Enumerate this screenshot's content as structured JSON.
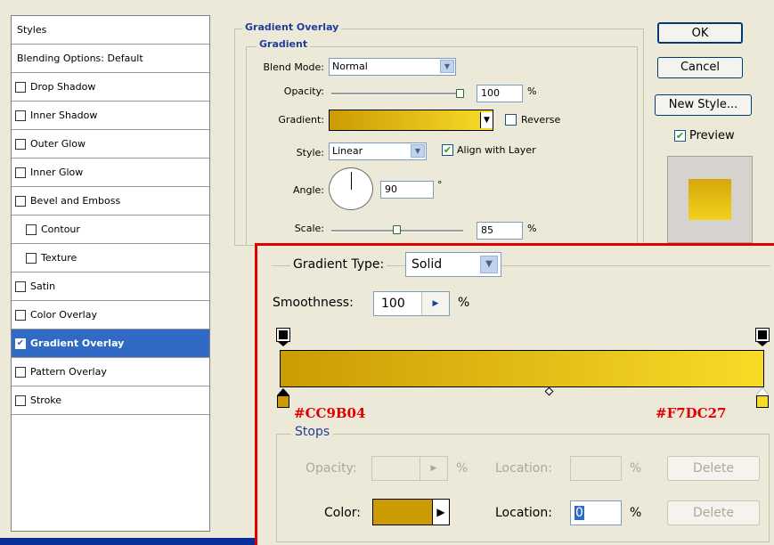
{
  "styles_list": {
    "header": "Styles",
    "blending": "Blending Options: Default",
    "items": [
      {
        "label": "Drop Shadow",
        "checked": false,
        "indent": false
      },
      {
        "label": "Inner Shadow",
        "checked": false,
        "indent": false
      },
      {
        "label": "Outer Glow",
        "checked": false,
        "indent": false
      },
      {
        "label": "Inner Glow",
        "checked": false,
        "indent": false
      },
      {
        "label": "Bevel and Emboss",
        "checked": false,
        "indent": false
      },
      {
        "label": "Contour",
        "checked": false,
        "indent": true
      },
      {
        "label": "Texture",
        "checked": false,
        "indent": true
      },
      {
        "label": "Satin",
        "checked": false,
        "indent": false
      },
      {
        "label": "Color Overlay",
        "checked": false,
        "indent": false
      },
      {
        "label": "Gradient Overlay",
        "checked": true,
        "indent": false,
        "selected": true
      },
      {
        "label": "Pattern Overlay",
        "checked": false,
        "indent": false
      },
      {
        "label": "Stroke",
        "checked": false,
        "indent": false
      }
    ]
  },
  "gradient_overlay": {
    "section_title": "Gradient Overlay",
    "subsection_title": "Gradient",
    "blend_mode_label": "Blend Mode:",
    "blend_mode_value": "Normal",
    "opacity_label": "Opacity:",
    "opacity_value": "100",
    "opacity_unit": "%",
    "gradient_label": "Gradient:",
    "reverse_label": "Reverse",
    "reverse_checked": false,
    "style_label": "Style:",
    "style_value": "Linear",
    "align_label": "Align with Layer",
    "align_checked": true,
    "angle_label": "Angle:",
    "angle_value": "90",
    "angle_unit": "°",
    "scale_label": "Scale:",
    "scale_value": "85",
    "scale_unit": "%"
  },
  "buttons": {
    "ok": "OK",
    "cancel": "Cancel",
    "new_style": "New Style...",
    "preview_label": "Preview",
    "preview_checked": true
  },
  "gradient_editor": {
    "type_label": "Gradient Type:",
    "type_value": "Solid",
    "smoothness_label": "Smoothness:",
    "smoothness_value": "100",
    "smoothness_unit": "%",
    "left_color_hex": "#CC9B04",
    "right_color_hex": "#F7DC27",
    "stops_title": "Stops",
    "opacity_label": "Opacity:",
    "opacity_unit": "%",
    "location_label_1": "Location:",
    "location_unit_1": "%",
    "delete_label_1": "Delete",
    "color_label": "Color:",
    "location_label_2": "Location:",
    "location_value_2": "0",
    "location_unit_2": "%",
    "delete_label_2": "Delete"
  },
  "colors": {
    "gradient_start": "#CC9B04",
    "gradient_end": "#F7DC27",
    "selection": "#316ac5",
    "highlight_red": "#e00000"
  }
}
